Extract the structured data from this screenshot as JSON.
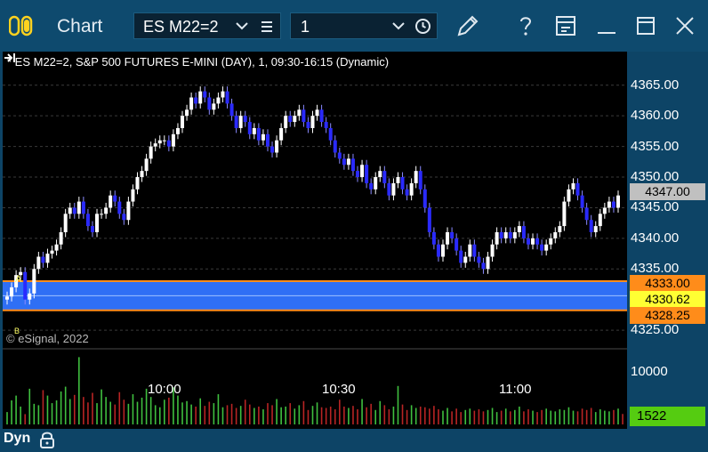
{
  "window": {
    "title": "Chart",
    "symbol": "ES M22=2",
    "interval": "1",
    "toolbar_icons": [
      "symbol-dropdown-icon",
      "symbol-menu-icon",
      "interval-dropdown-icon",
      "clock-icon",
      "pencil-icon",
      "help-icon",
      "layout-icon",
      "minimize-icon",
      "maximize-icon",
      "close-icon"
    ]
  },
  "chart": {
    "title": "* ES M22=2, S&P 500 FUTURES E-MINI (DAY), 1, 09:30-16:15 (Dynamic)",
    "copyright": "© eSignal, 2022",
    "price_labels": [
      "4365.00",
      "4360.00",
      "4355.00",
      "4350.00",
      "4345.00",
      "4340.00",
      "4335.00",
      "4325.00"
    ],
    "volume_labels": [
      "10000"
    ],
    "time_labels": [
      "10:00",
      "10:30",
      "11:00"
    ],
    "footer_label": "Dyn",
    "markers": {
      "a": "A",
      "b": "B"
    },
    "badges": {
      "last": "4347.00",
      "band_top": "4333.00",
      "band_mid": "4330.62",
      "band_bottom": "4328.25",
      "volume": "1522"
    },
    "colors": {
      "up": "#ffffff",
      "down": "#2a2aff",
      "band": "#2f6ff5",
      "band_edge": "#ff8c1a",
      "vol_up": "#3fbf3f",
      "vol_down": "#b82424",
      "badge_last": "#c0c0c0",
      "badge_band": "#ff8c1a",
      "badge_mid": "#ffff33",
      "badge_vol": "#55cc11"
    }
  },
  "chart_data": {
    "type": "candlestick",
    "title": "* ES M22=2, S&P 500 FUTURES E-MINI (DAY), 1, 09:30-16:15 (Dynamic)",
    "y_range": [
      4324,
      4367
    ],
    "y_ticks": [
      4325,
      4335,
      4340,
      4345,
      4350,
      4355,
      4360,
      4365
    ],
    "x_ticks": [
      "10:00",
      "10:30",
      "11:00"
    ],
    "band": {
      "top": 4333.0,
      "mid": 4330.62,
      "bottom": 4328.25
    },
    "last_price": 4347.0,
    "last_volume": 1522,
    "closes": [
      4330.5,
      4332,
      4334,
      4334.5,
      4330,
      4331,
      4335,
      4337,
      4336,
      4337.5,
      4338,
      4339,
      4341,
      4344,
      4345,
      4344,
      4346,
      4344,
      4342,
      4341,
      4344,
      4344,
      4345,
      4347,
      4346,
      4344,
      4343,
      4346,
      4348,
      4350,
      4351,
      4353,
      4355,
      4355.5,
      4356,
      4356,
      4355,
      4357,
      4358,
      4360,
      4361,
      4363,
      4362,
      4364,
      4363,
      4361,
      4362,
      4363,
      4364,
      4362,
      4360,
      4358,
      4360,
      4359,
      4357,
      4358,
      4356,
      4357,
      4355,
      4354,
      4356,
      4358,
      4360,
      4359,
      4360,
      4361,
      4359,
      4358,
      4360,
      4361,
      4359,
      4358,
      4356,
      4354,
      4353,
      4352,
      4353,
      4351,
      4350,
      4352,
      4349,
      4348,
      4350,
      4351,
      4349,
      4347,
      4349,
      4350,
      4348,
      4347,
      4349,
      4351,
      4348,
      4345,
      4341,
      4339,
      4337,
      4339,
      4341,
      4340,
      4338,
      4336,
      4337,
      4339,
      4337,
      4336,
      4335,
      4337,
      4339,
      4341,
      4340,
      4341,
      4340,
      4341,
      4342,
      4340,
      4339,
      4340,
      4339,
      4338,
      4339,
      4340,
      4341,
      4342,
      4346,
      4348,
      4349,
      4347,
      4345,
      4343,
      4341,
      4342,
      4344,
      4345,
      4346,
      4345,
      4347
    ],
    "volumes": [
      1800,
      3500,
      4200,
      2600,
      1500,
      5200,
      3000,
      2800,
      5000,
      4200,
      3100,
      3500,
      4800,
      5500,
      3700,
      4300,
      9800,
      4000,
      3200,
      4600,
      3100,
      5100,
      4000,
      3300,
      2900,
      4700,
      3600,
      3000,
      4400,
      3300,
      3900,
      5200,
      4000,
      2800,
      2500,
      3600,
      3900,
      5400,
      4200,
      3200,
      3400,
      2900,
      2600,
      3800,
      2700,
      3300,
      3100,
      4400,
      2500,
      2800,
      3000,
      2400,
      2700,
      3600,
      2900,
      2400,
      2600,
      2200,
      3100,
      2800,
      3700,
      2500,
      2600,
      3100,
      2300,
      2800,
      3400,
      2100,
      2700,
      3200,
      2500,
      2400,
      2600,
      2200,
      3600,
      2600,
      2400,
      2700,
      2200,
      3700,
      2500,
      3000,
      2100,
      3400,
      2800,
      2200,
      2600,
      5600,
      2900,
      2100,
      2800,
      2400,
      2600,
      2500,
      2300,
      2700,
      2200,
      2000,
      2400,
      1900,
      2300,
      1800,
      2100,
      2300,
      2000,
      2200,
      1900,
      2100,
      2400,
      1800,
      2000,
      2300,
      1900,
      2100,
      2600,
      1900,
      2200,
      2000,
      1800,
      2100,
      2300,
      2000,
      1900,
      2200,
      2100,
      2500,
      2000,
      1900,
      2300,
      2100,
      2400,
      1800,
      2200,
      2000,
      1900,
      2100,
      2300,
      1522
    ]
  }
}
